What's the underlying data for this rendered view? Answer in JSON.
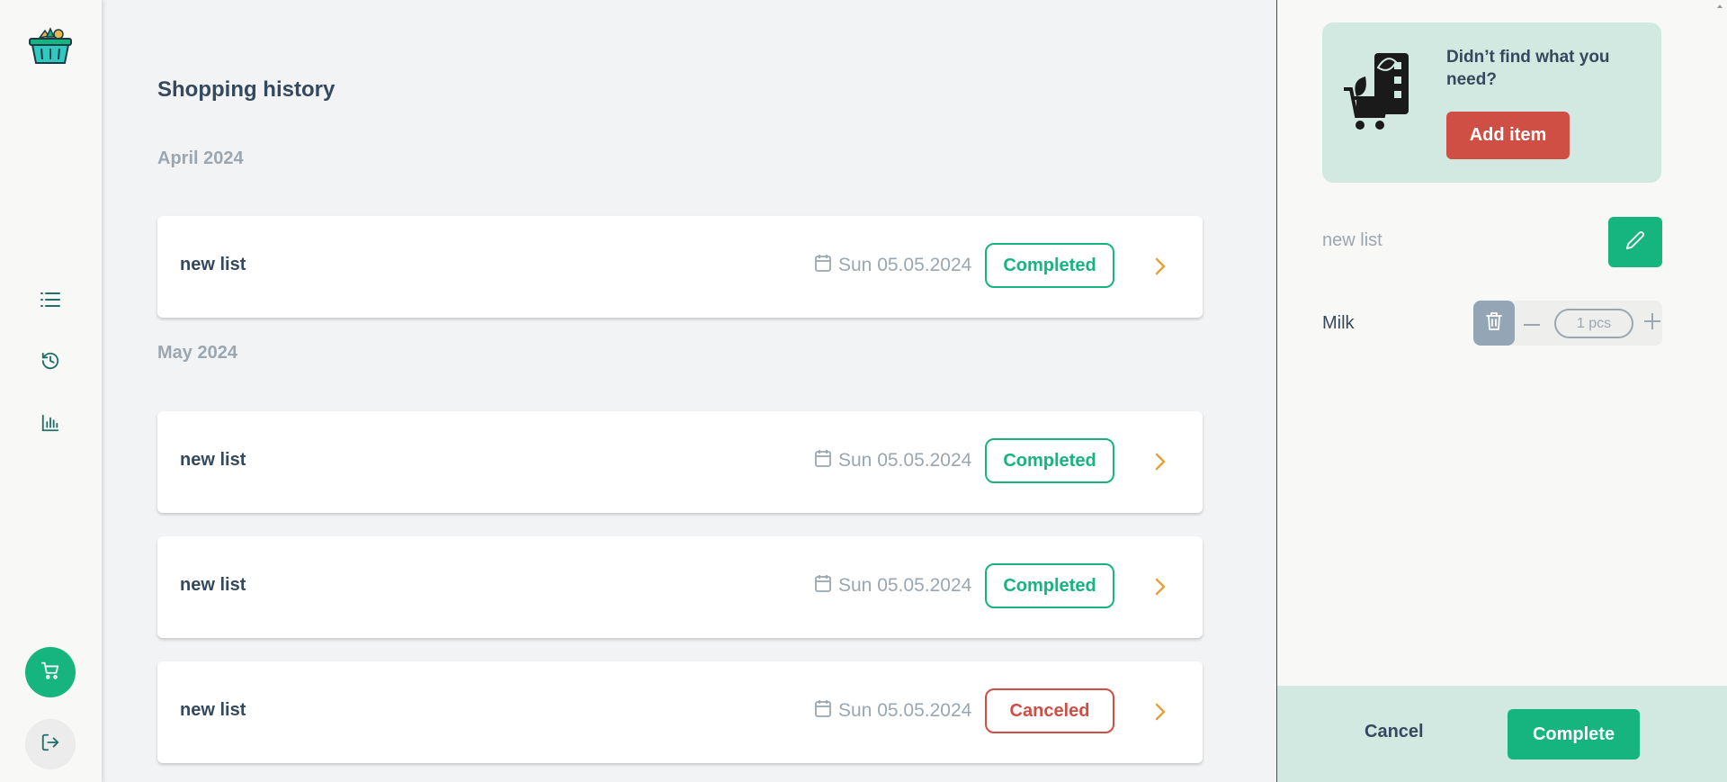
{
  "sidebar": {
    "logo_icon": "grocery-basket-logo",
    "nav": [
      {
        "icon": "list-icon"
      },
      {
        "icon": "history-icon"
      },
      {
        "icon": "bar-chart-icon"
      }
    ],
    "cart_icon": "cart-icon",
    "logout_icon": "logout-icon"
  },
  "main": {
    "title": "Shopping history",
    "groups": [
      {
        "month": "April 2024",
        "lists": [
          {
            "name": "new list",
            "date": "Sun 05.05.2024",
            "status": "Completed"
          }
        ]
      },
      {
        "month": "May 2024",
        "lists": [
          {
            "name": "new list",
            "date": "Sun 05.05.2024",
            "status": "Completed"
          },
          {
            "name": "new list",
            "date": "Sun 05.05.2024",
            "status": "Completed"
          },
          {
            "name": "new list",
            "date": "Sun 05.05.2024",
            "status": "Canceled"
          }
        ]
      }
    ]
  },
  "panel": {
    "promo_text": "Didn’t find what you need?",
    "add_item_label": "Add item",
    "list_name": "new list",
    "items": [
      {
        "name": "Milk",
        "quantity": "1 pcs"
      }
    ],
    "cancel_label": "Cancel",
    "complete_label": "Complete"
  },
  "colors": {
    "accent_green": "#16b47e",
    "cancel_red": "#cf4f45",
    "promo_bg": "#d2e9e1",
    "chevron_gold": "#e0a43a"
  }
}
